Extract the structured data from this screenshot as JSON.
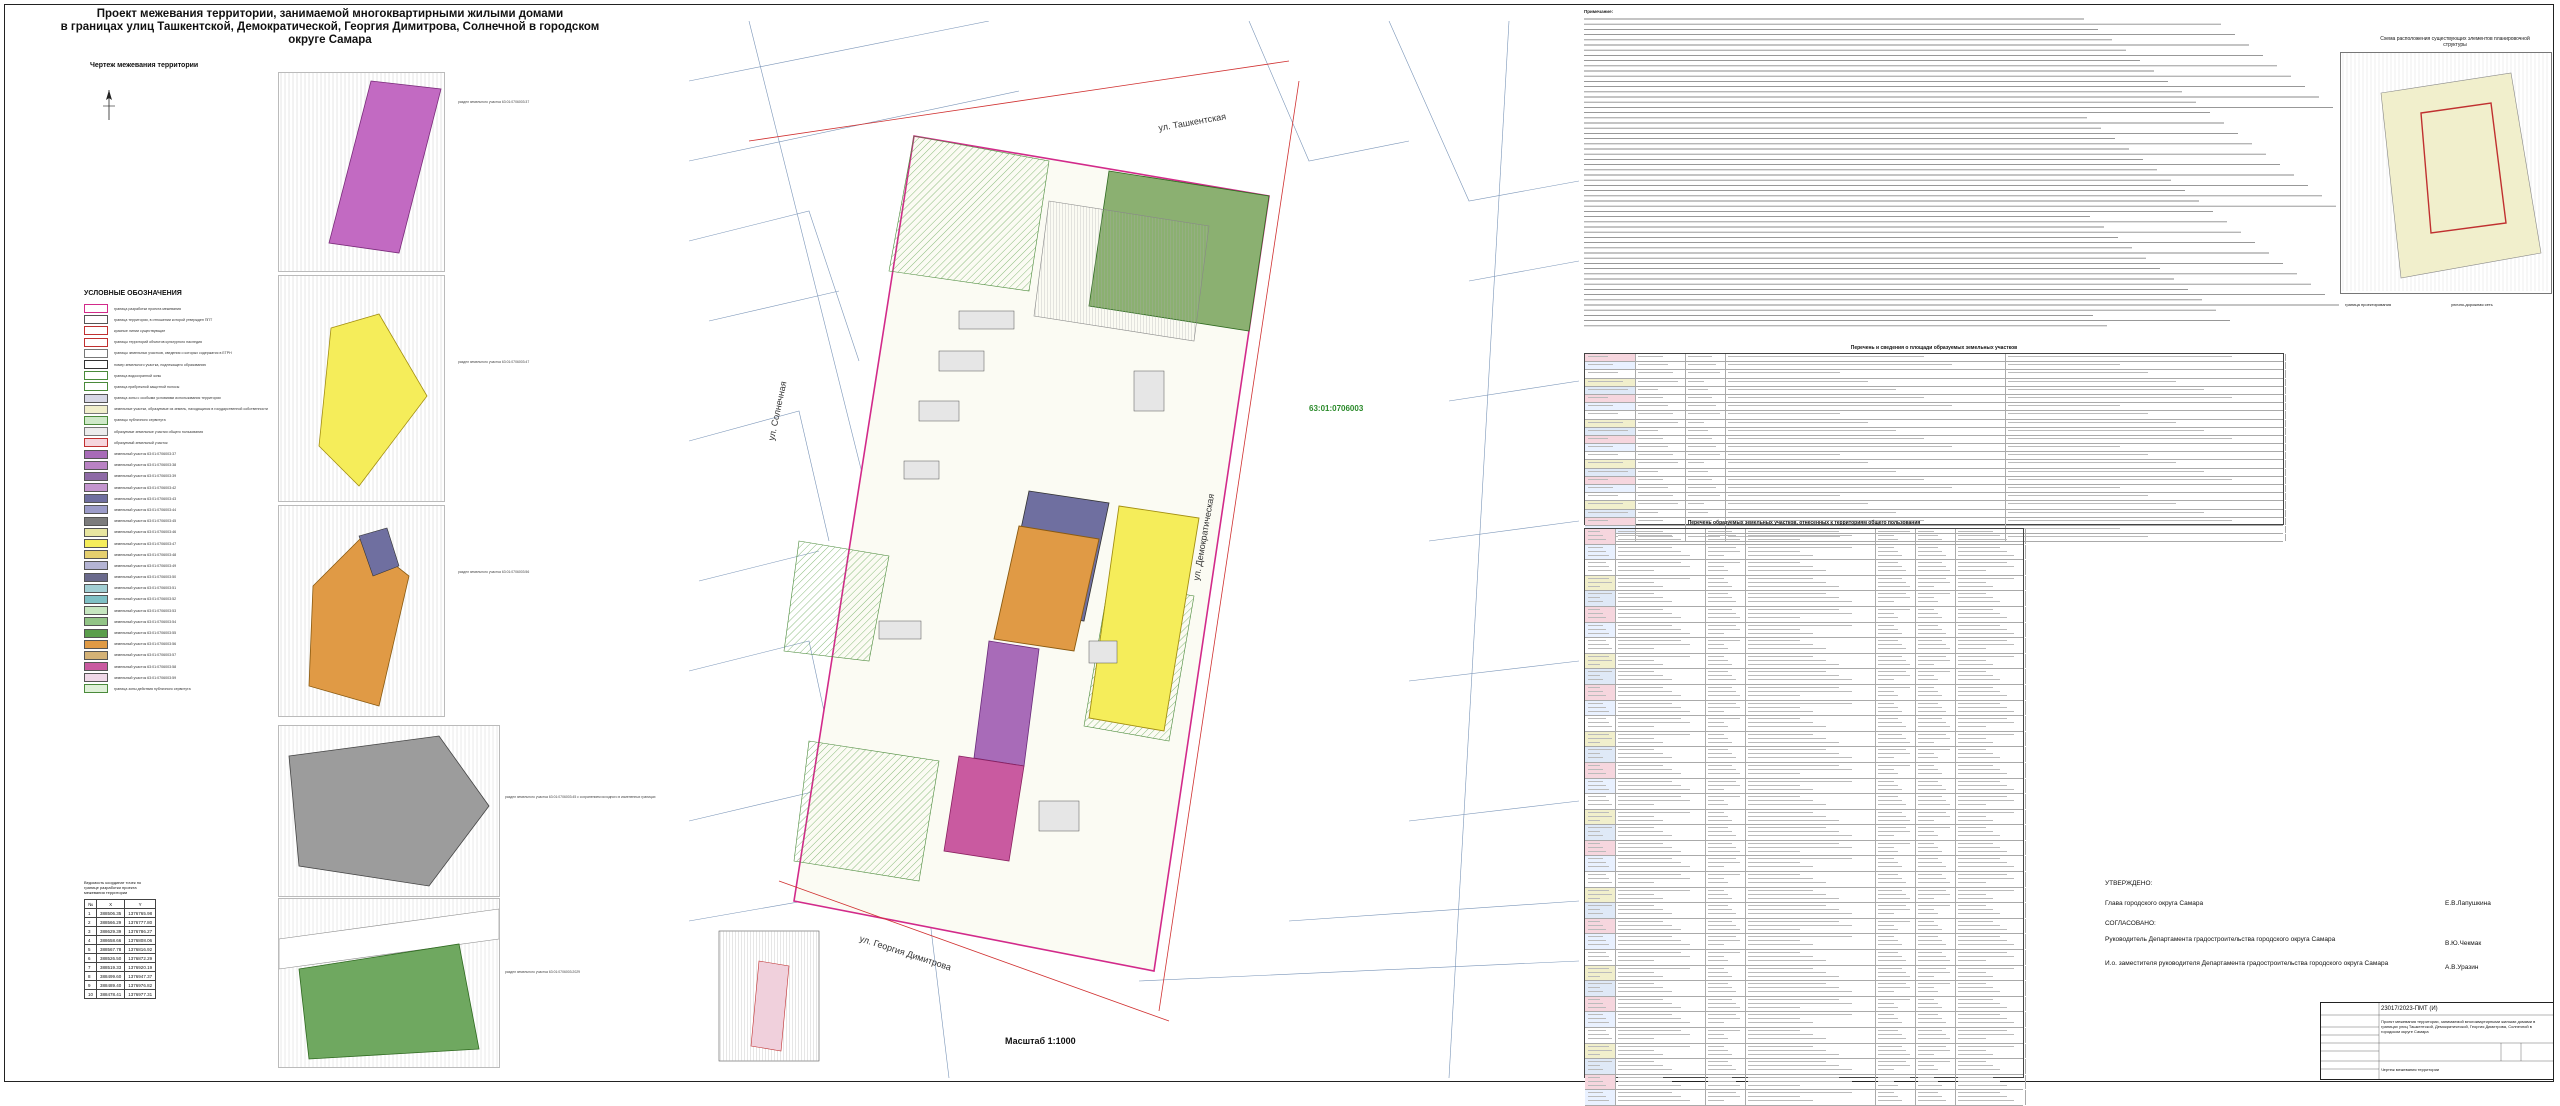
{
  "header": {
    "title_lines": [
      "Проект межевания территории, занимаемой многоквартирными жилыми домами",
      "в границах улиц Ташкентской, Демократической, Георгия Димитрова, Солнечной в городском округе Самара"
    ],
    "drawing_caption": "Чертеж межевания территории"
  },
  "legend": {
    "heading": "УСЛОВНЫЕ ОБОЗНАЧЕНИЯ",
    "items": [
      {
        "color": "#ffffff",
        "border": "#d22a8a",
        "text": "граница разработки проекта межевания"
      },
      {
        "color": "#ffffff",
        "border": "#555555",
        "text": "граница территории, в отношении которой утвержден ППТ"
      },
      {
        "color": "#ffffff",
        "border": "#c03030",
        "text": "красные линии существующие"
      },
      {
        "color": "#ffffff",
        "border": "#c03030",
        "text": "границы территорий объектов культурного наследия"
      },
      {
        "color": "#ffffff",
        "border": "#777777",
        "text": "границы земельных участков, сведения о которых содержатся в ЕГРН"
      },
      {
        "color": "#ffffff",
        "border": "#333333",
        "text": "номер земельного участка, подлежащего образованию"
      },
      {
        "color": "#ffffff",
        "border": "#4a8a3a",
        "text": "граница водоохранной зоны"
      },
      {
        "color": "#ffffff",
        "border": "#4a8a3a",
        "text": "граница прибрежной защитной полосы"
      },
      {
        "color": "#d7d7e6",
        "border": "#555555",
        "text": "граница зоны с особыми условиями использования территории"
      },
      {
        "color": "#f1efcc",
        "border": "#777777",
        "text": "земельные участки, образуемые из земель, находящихся в государственной собственности"
      },
      {
        "color": "#cfe9c9",
        "border": "#4a8a3a",
        "text": "границы публичного сервитута"
      },
      {
        "color": "#ececec",
        "border": "#777777",
        "text": "образуемые земельные участки общего пользования"
      },
      {
        "color": "#f6d6de",
        "border": "#c03030",
        "text": "образуемый земельный участок"
      },
      {
        "color": "#a86bb8",
        "border": "#555555",
        "text": "земельный участок 63:01:0706003:37"
      },
      {
        "color": "#b982c4",
        "border": "#555555",
        "text": "земельный участок 63:01:0706003:38"
      },
      {
        "color": "#8e6aa6",
        "border": "#555555",
        "text": "земельный участок 63:01:0706003:39"
      },
      {
        "color": "#c495cf",
        "border": "#555555",
        "text": "земельный участок 63:01:0706003:42"
      },
      {
        "color": "#6f6fa0",
        "border": "#555555",
        "text": "земельный участок 63:01:0706003:43"
      },
      {
        "color": "#9c9cc9",
        "border": "#555555",
        "text": "земельный участок 63:01:0706003:44"
      },
      {
        "color": "#7c7c7c",
        "border": "#555555",
        "text": "земельный участок 63:01:0706003:45"
      },
      {
        "color": "#e8e6a0",
        "border": "#555555",
        "text": "земельный участок 63:01:0706003:46"
      },
      {
        "color": "#f5ed5a",
        "border": "#555555",
        "text": "земельный участок 63:01:0706003:47"
      },
      {
        "color": "#e5cf6e",
        "border": "#555555",
        "text": "земельный участок 63:01:0706003:48"
      },
      {
        "color": "#b4b4d4",
        "border": "#555555",
        "text": "земельный участок 63:01:0706003:49"
      },
      {
        "color": "#6a6a8c",
        "border": "#555555",
        "text": "земельный участок 63:01:0706003:50"
      },
      {
        "color": "#a2cfd4",
        "border": "#555555",
        "text": "земельный участок 63:01:0706003:51"
      },
      {
        "color": "#7ec0c5",
        "border": "#555555",
        "text": "земельный участок 63:01:0706003:52"
      },
      {
        "color": "#c6e6c0",
        "border": "#555555",
        "text": "земельный участок 63:01:0706003:53"
      },
      {
        "color": "#92c486",
        "border": "#555555",
        "text": "земельный участок 63:01:0706003:54"
      },
      {
        "color": "#5b9e4c",
        "border": "#555555",
        "text": "земельный участок 63:01:0706003:55"
      },
      {
        "color": "#e09a45",
        "border": "#555555",
        "text": "земельный участок 63:01:0706003:56"
      },
      {
        "color": "#d4b276",
        "border": "#555555",
        "text": "земельный участок 63:01:0706003:57"
      },
      {
        "color": "#c95aa0",
        "border": "#555555",
        "text": "земельный участок 63:01:0706003:58"
      },
      {
        "color": "#f0d8e8",
        "border": "#555555",
        "text": "земельный участок 63:01:0706003:59"
      },
      {
        "color": "#dff0d8",
        "border": "#4a8a3a",
        "text": "граница зоны действия публичного сервитута"
      }
    ]
  },
  "coords": {
    "caption": "Ведомость координат точек по границе разработки проекта межевания территории",
    "headers": [
      "№",
      "X",
      "Y"
    ],
    "rows": [
      [
        "1",
        "388506.35",
        "1376765.98"
      ],
      [
        "2",
        "388566.29",
        "1376777.80"
      ],
      [
        "3",
        "388629.39",
        "1376786.27"
      ],
      [
        "4",
        "388658.66",
        "1376808.06"
      ],
      [
        "5",
        "388567.78",
        "1376816.92"
      ],
      [
        "6",
        "388526.50",
        "1376872.29"
      ],
      [
        "7",
        "388519.33",
        "1376920.19"
      ],
      [
        "8",
        "388499.60",
        "1376947.37"
      ],
      [
        "9",
        "388489.40",
        "1376976.82"
      ],
      [
        "10",
        "388478.41",
        "1376977.31"
      ]
    ]
  },
  "thumbs": [
    {
      "id": "t1",
      "label": "раздел земельного участка 63:01:0706003:37",
      "color": "#c26ac2"
    },
    {
      "id": "t2",
      "label": "раздел земельного участка 63:01:0706003:47",
      "color": "#f5ed5a"
    },
    {
      "id": "t3",
      "label": "раздел земельного участка 63:01:0706003:56",
      "color": "#e09a45"
    },
    {
      "id": "t4",
      "label": "раздел земельного участка 63:01:0706003:45 с сохранением исходного в измененных границах",
      "color": "#9c9c9c"
    },
    {
      "id": "t5",
      "label": "раздел земельного участка 63:01:0706003:2029",
      "color": "#6fa860"
    }
  ],
  "map": {
    "streets": [
      "ул. Ташкентская",
      "ул. Демократическая",
      "ул. Георгия Димитрова",
      "ул. Солнечная"
    ],
    "block_label": "63:01:0706003",
    "scale": "Масштаб 1:1000"
  },
  "notes": {
    "heading": "Примечание:"
  },
  "tables": {
    "t1_title": "Перечень и сведения о площади образуемых земельных участков",
    "t2_title": "Перечень образуемых земельных участков, отнесенных к территориям общего пользования"
  },
  "schema": {
    "title": "Схема расположения существующих элементов планировочной структуры",
    "labels": [
      "граница проектирования",
      "улично-дорожная сеть"
    ]
  },
  "approval": {
    "approved": "УТВЕРЖДЕНО:",
    "head": "Глава городского округа Самара",
    "head_sig": "Е.В.Лапушкина",
    "agreed": "СОГЛАСОВАНО:",
    "dept": "Руководитель Департамента градостроительства городского округа Самара",
    "dept_sig": "В.Ю.Чекмак",
    "deputy": "И.о. заместителя руководителя Департамента градостроительства городского округа Самара",
    "deputy_sig": "А.В.Уразин"
  },
  "stamp": {
    "code": "23017/2023-ПМТ (И)",
    "description": "Проект межевания территории, занимаемой многоквартирными жилыми домами в границах улиц Ташкентской, Демократической, Георгия Димитрова, Солнечной в городском округе Самара",
    "sheet_name": "Чертеж межевания территории"
  }
}
